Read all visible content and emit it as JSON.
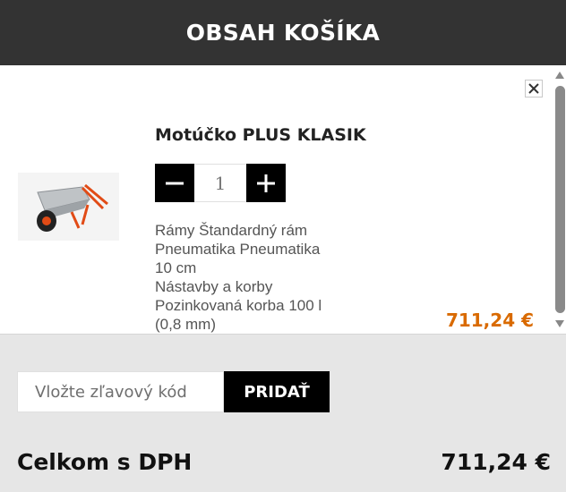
{
  "header": {
    "title": "OBSAH KOŠÍKA"
  },
  "cart": {
    "items": [
      {
        "name": "Motúčko PLUS KLASIK",
        "quantity": "1",
        "variant_lines": [
          "Rámy Štandardný rám",
          "Pneumatika Pneumatika",
          "10 cm",
          "Nástavby a korby",
          "Pozinkovaná korba 100 l",
          "(0,8 mm)"
        ],
        "price": "711,24 €",
        "image_icon": "wheelbarrow-image"
      }
    ]
  },
  "discount": {
    "placeholder": "Vložte zľavový kód",
    "button_label": "PRIDAŤ"
  },
  "total": {
    "label": "Celkom s DPH",
    "value": "711,24 €"
  },
  "colors": {
    "header_bg": "#333333",
    "price_accent": "#d96a00",
    "footer_bg": "#e6e6e6"
  }
}
